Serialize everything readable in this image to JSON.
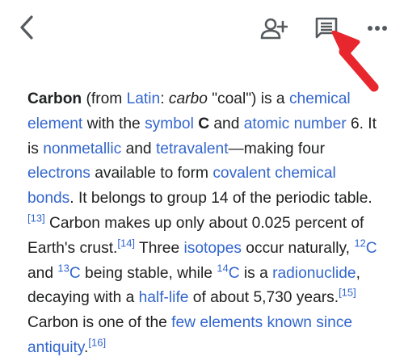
{
  "toolbar": {
    "icons": {
      "back": "chevron-left-icon",
      "add_contact": "person-add-icon",
      "notes": "message-notes-icon",
      "more": "more-dots-icon"
    }
  },
  "annotation": {
    "color": "#e8262d"
  },
  "colors": {
    "text": "#202122",
    "link": "#3366cc",
    "icon": "#555a5f"
  },
  "article": {
    "t1": "Carbon",
    "t2": " (from ",
    "l_latin": "Latin",
    "t3": ": ",
    "t4": "carbo",
    "t5": " \"coal\") is a ",
    "l_chem_el": "chemical element",
    "t6": " with the ",
    "l_symbol": "symbol",
    "t7": " ",
    "t8": "C",
    "t9": " and ",
    "l_atomic": "atomic number",
    "t10": " 6. It is ",
    "l_nonmet": "nonmetallic",
    "t11": " and ",
    "l_tetra": "tetravalent",
    "t12": "—making four ",
    "l_electrons": "electrons",
    "t13": " available to form ",
    "l_covalent": "covalent chemical bonds",
    "t14": ". It belongs to group 14 of the periodic table.",
    "r13": "[13]",
    "t15": " Carbon makes up only about 0.025 percent of Earth's crust.",
    "r14": "[14]",
    "t16": " Three ",
    "l_isotopes": "isotopes",
    "t17": " occur naturally, ",
    "s12": "12",
    "c1": "C",
    "t18": " and ",
    "s13": "13",
    "c2": "C",
    "t19": " being stable, while ",
    "s14": "14",
    "c3": "C",
    "t20": " is a ",
    "l_radio": "radionuclide",
    "t21": ", decaying with a ",
    "l_halflife": "half-life",
    "t22": " of about 5,730 years.",
    "r15": "[15]",
    "t23": " Carbon is one of the ",
    "l_few": "few elements known since antiquity",
    "t24": ".",
    "r16": "[16]"
  }
}
